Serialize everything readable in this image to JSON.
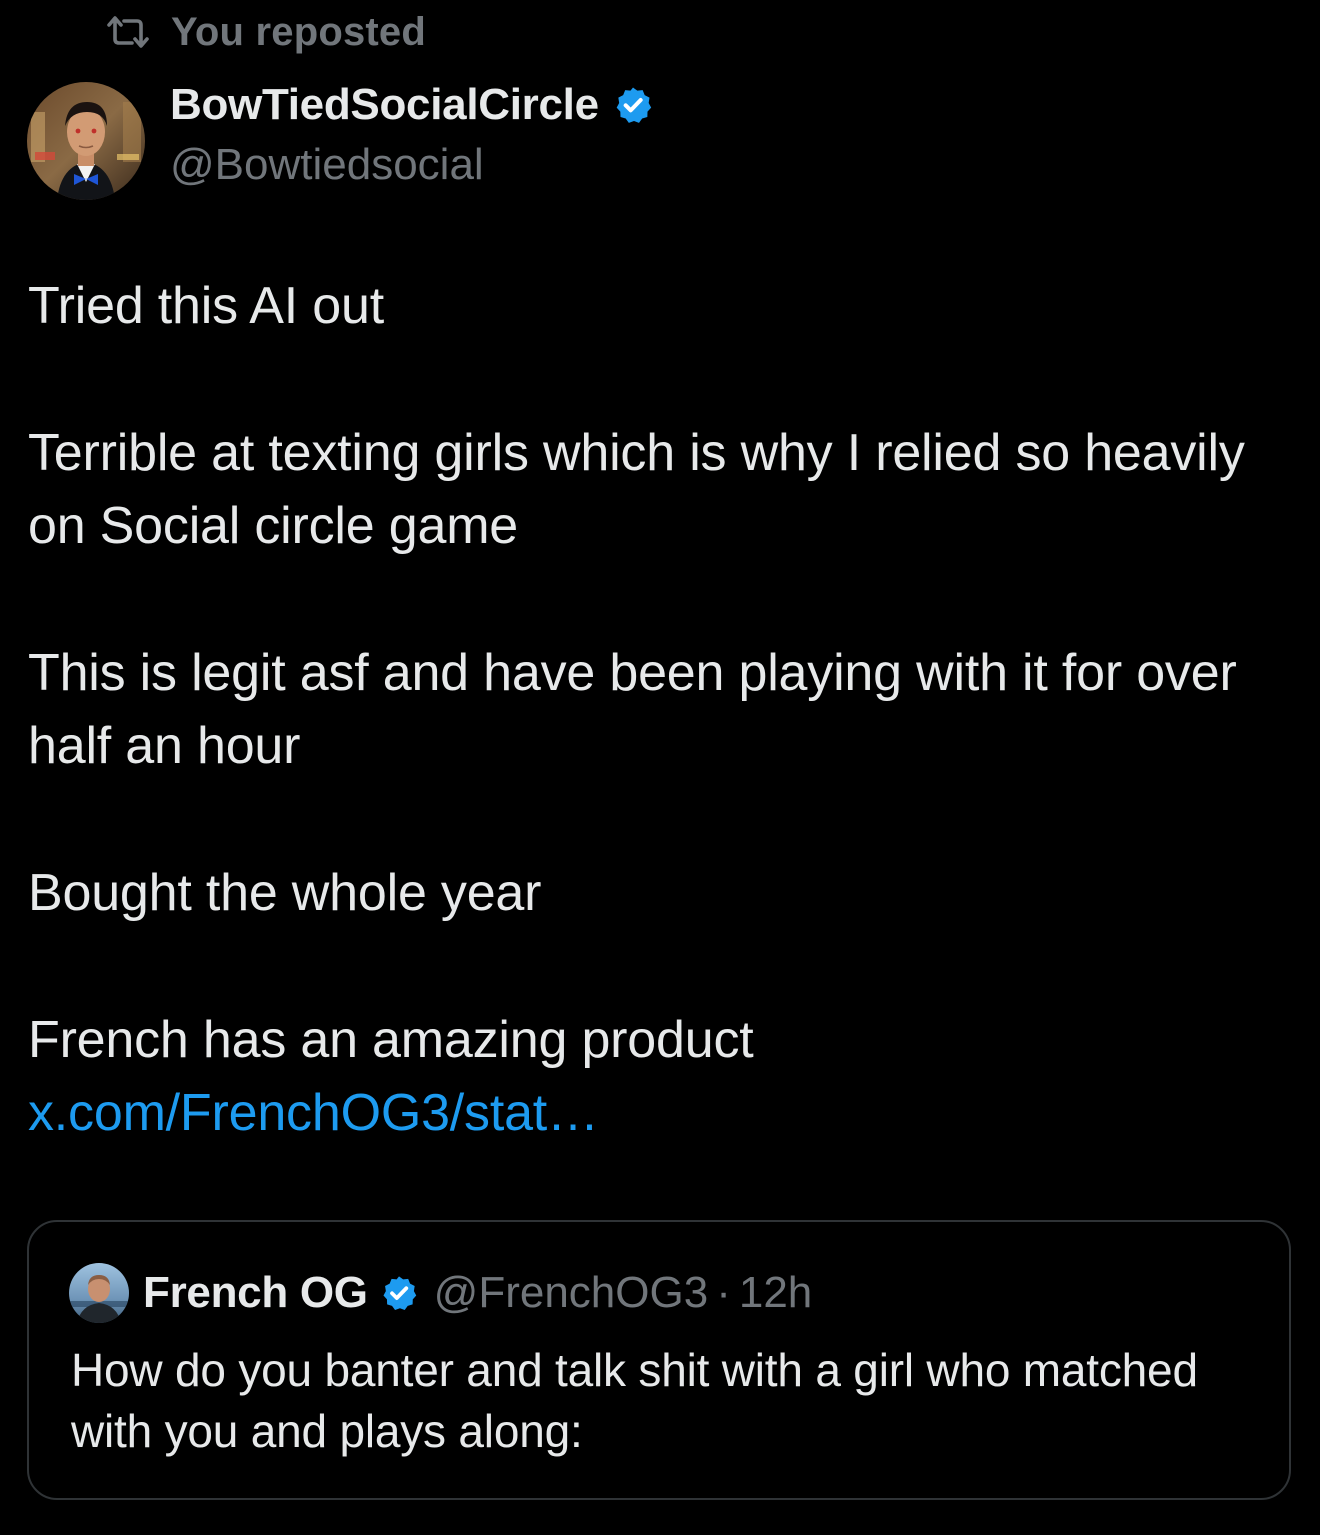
{
  "repost": {
    "icon": "repost-icon",
    "label": "You reposted"
  },
  "author": {
    "display_name": "BowTiedSocialCircle",
    "handle": "@Bowtiedsocial",
    "verified": true,
    "verified_color": "#1d9bf0"
  },
  "tweet": {
    "paragraphs": [
      "Tried this AI out",
      "Terrible at texting girls which is why I relied so heavily on Social circle game",
      "This is legit asf and have been playing with it for over half an hour",
      "Bought the whole year"
    ],
    "last_paragraph_text": "French has an amazing product ",
    "link_text": "x.com/FrenchOG3/stat…"
  },
  "quote": {
    "display_name": "French OG",
    "handle": "@FrenchOG3",
    "separator": "·",
    "time": "12h",
    "verified": true,
    "text": "How do you banter and talk shit with a girl who matched with you and plays along:"
  },
  "colors": {
    "background": "#000000",
    "primary_text": "#e7e9ea",
    "secondary_text": "#71767b",
    "link": "#1d9bf0",
    "border": "#2f3336"
  }
}
